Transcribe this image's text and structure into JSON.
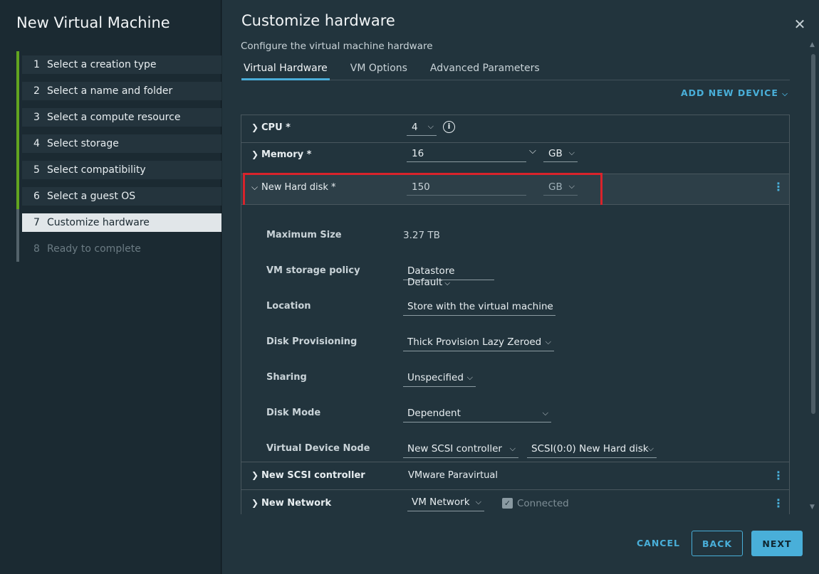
{
  "sidebar": {
    "title": "New Virtual Machine",
    "steps": [
      {
        "num": "1",
        "label": "Select a creation type"
      },
      {
        "num": "2",
        "label": "Select a name and folder"
      },
      {
        "num": "3",
        "label": "Select a compute resource"
      },
      {
        "num": "4",
        "label": "Select storage"
      },
      {
        "num": "5",
        "label": "Select compatibility"
      },
      {
        "num": "6",
        "label": "Select a guest OS"
      },
      {
        "num": "7",
        "label": "Customize hardware"
      },
      {
        "num": "8",
        "label": "Ready to complete"
      }
    ]
  },
  "main": {
    "title": "Customize hardware",
    "subtitle": "Configure the virtual machine hardware",
    "tabs": [
      {
        "label": "Virtual Hardware"
      },
      {
        "label": "VM Options"
      },
      {
        "label": "Advanced Parameters"
      }
    ],
    "add_device": "ADD NEW DEVICE"
  },
  "hardware": {
    "cpu": {
      "label": "CPU *",
      "value": "4"
    },
    "memory": {
      "label": "Memory *",
      "value": "16",
      "unit": "GB"
    },
    "hard_disk": {
      "label": "New Hard disk *",
      "value": "150",
      "unit": "GB",
      "details": {
        "max_size_label": "Maximum Size",
        "max_size_value": "3.27 TB",
        "storage_policy_label": "VM storage policy",
        "storage_policy_value": "Datastore Default",
        "location_label": "Location",
        "location_value": "Store with the virtual machine",
        "provisioning_label": "Disk Provisioning",
        "provisioning_value": "Thick Provision Lazy Zeroed",
        "sharing_label": "Sharing",
        "sharing_value": "Unspecified",
        "mode_label": "Disk Mode",
        "mode_value": "Dependent",
        "node_label": "Virtual Device Node",
        "node_controller": "New SCSI controller",
        "node_slot": "SCSI(0:0) New Hard disk"
      }
    },
    "scsi": {
      "label": "New SCSI controller",
      "value": "VMware Paravirtual"
    },
    "network": {
      "label": "New Network",
      "value": "VM Network",
      "connected_label": "Connected"
    }
  },
  "footer": {
    "cancel": "CANCEL",
    "back": "BACK",
    "next": "NEXT"
  },
  "colors": {
    "accent": "#49afd9",
    "completed_step": "#62a420",
    "highlight": "#d9232b"
  }
}
